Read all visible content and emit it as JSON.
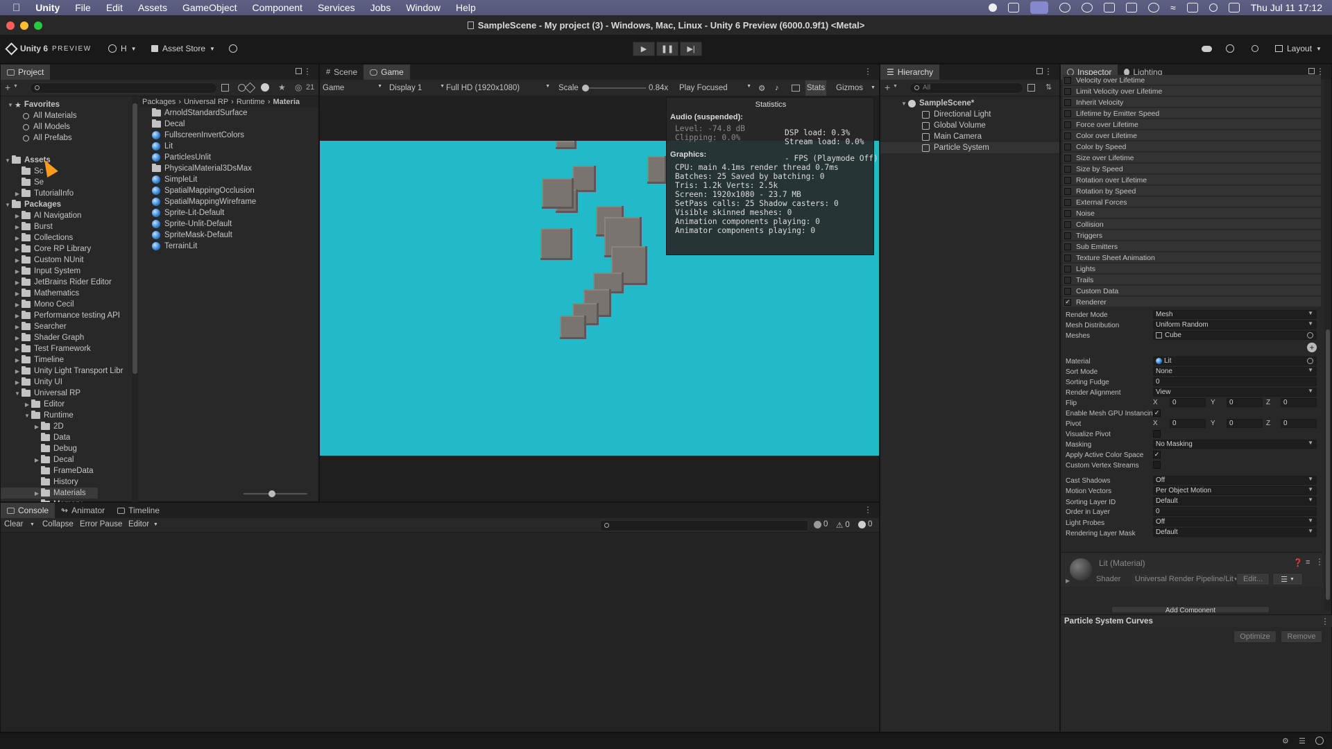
{
  "macbar": {
    "app": "Unity",
    "menus": [
      "File",
      "Edit",
      "Assets",
      "GameObject",
      "Component",
      "Services",
      "Jobs",
      "Window",
      "Help"
    ],
    "clock": "Thu Jul 11  17:12"
  },
  "window": {
    "title": "SampleScene - My project (3) - Windows, Mac, Linux - Unity 6 Preview (6000.0.9f1) <Metal>"
  },
  "toolbar": {
    "brand": "Unity 6",
    "brand_suffix": "PREVIEW",
    "account_label": "H",
    "asset_store": "Asset Store",
    "layout": "Layout"
  },
  "project": {
    "tab": "Project",
    "hidden_count": "21",
    "favorites_label": "Favorites",
    "favorites": [
      "All Materials",
      "All Models",
      "All Prefabs"
    ],
    "assets_label": "Assets",
    "assets_children": [
      "Sc",
      "Se",
      "TutorialInfo"
    ],
    "packages_label": "Packages",
    "packages": [
      "AI Navigation",
      "Burst",
      "Collections",
      "Core RP Library",
      "Custom NUnit",
      "Input System",
      "JetBrains Rider Editor",
      "Mathematics",
      "Mono Cecil",
      "Performance testing API",
      "Searcher",
      "Shader Graph",
      "Test Framework",
      "Timeline",
      "Unity Light Transport Libr",
      "Unity UI"
    ],
    "urp_label": "Universal RP",
    "urp_children": [
      "Editor",
      "Runtime"
    ],
    "runtime_children": [
      "2D",
      "Data",
      "Debug",
      "Decal",
      "FrameData",
      "History",
      "Materials",
      "Memory"
    ],
    "breadcrumb": [
      "Packages",
      "Universal RP",
      "Runtime",
      "Materia"
    ],
    "files": [
      {
        "name": "ArnoldStandardSurface",
        "kind": "folder"
      },
      {
        "name": "Decal",
        "kind": "folder"
      },
      {
        "name": "FullscreenInvertColors",
        "kind": "mat"
      },
      {
        "name": "Lit",
        "kind": "mat"
      },
      {
        "name": "ParticlesUnlit",
        "kind": "mat"
      },
      {
        "name": "PhysicalMaterial3DsMax",
        "kind": "folder"
      },
      {
        "name": "SimpleLit",
        "kind": "mat"
      },
      {
        "name": "SpatialMappingOcclusion",
        "kind": "mat"
      },
      {
        "name": "SpatialMappingWireframe",
        "kind": "mat"
      },
      {
        "name": "Sprite-Lit-Default",
        "kind": "mat"
      },
      {
        "name": "Sprite-Unlit-Default",
        "kind": "mat"
      },
      {
        "name": "SpriteMask-Default",
        "kind": "mat"
      },
      {
        "name": "TerrainLit",
        "kind": "mat"
      }
    ]
  },
  "game": {
    "tabs": [
      "Scene",
      "Game"
    ],
    "mode": "Game",
    "display": "Display 1",
    "resolution": "Full HD (1920x1080)",
    "scale_label": "Scale",
    "scale_value": "0.84x",
    "play_mode": "Play Focused",
    "stats_btn": "Stats",
    "gizmos_btn": "Gizmos",
    "scale_fraction": 0.05,
    "background_color": "#22b9c8"
  },
  "stats": {
    "title": "Statistics",
    "audio_head": "Audio (suspended):",
    "level": "Level: -74.8 dB",
    "clipping": "Clipping: 0.0%",
    "dsp": "DSP load: 0.3%",
    "stream": "Stream load: 0.0%",
    "graphics_head": "Graphics:",
    "fps": "- FPS (Playmode Off)",
    "lines": [
      "CPU: main 4.1ms  render thread 0.7ms",
      "Batches: 25     Saved by batching: 0",
      "Tris: 1.2k   Verts: 2.5k",
      "Screen: 1920x1080 - 23.7 MB",
      "SetPass calls: 25  Shadow casters: 0",
      "Visible skinned meshes: 0",
      "Animation components playing: 0",
      "Animator components playing: 0"
    ]
  },
  "hierarchy": {
    "tab": "Hierarchy",
    "search_placeholder": "All",
    "scene": "SampleScene*",
    "items": [
      "Directional Light",
      "Global Volume",
      "Main Camera",
      "Particle System"
    ]
  },
  "inspector": {
    "tabs": [
      "Inspector",
      "Lighting"
    ],
    "modules": [
      {
        "name": "Velocity over Lifetime",
        "checked": false
      },
      {
        "name": "Limit Velocity over Lifetime",
        "checked": false
      },
      {
        "name": "Inherit Velocity",
        "checked": false
      },
      {
        "name": "Lifetime by Emitter Speed",
        "checked": false
      },
      {
        "name": "Force over Lifetime",
        "checked": false
      },
      {
        "name": "Color over Lifetime",
        "checked": false
      },
      {
        "name": "Color by Speed",
        "checked": false
      },
      {
        "name": "Size over Lifetime",
        "checked": false
      },
      {
        "name": "Size by Speed",
        "checked": false
      },
      {
        "name": "Rotation over Lifetime",
        "checked": false
      },
      {
        "name": "Rotation by Speed",
        "checked": false
      },
      {
        "name": "External Forces",
        "checked": false
      },
      {
        "name": "Noise",
        "checked": false
      },
      {
        "name": "Collision",
        "checked": false
      },
      {
        "name": "Triggers",
        "checked": false
      },
      {
        "name": "Sub Emitters",
        "checked": false
      },
      {
        "name": "Texture Sheet Animation",
        "checked": false
      },
      {
        "name": "Lights",
        "checked": false
      },
      {
        "name": "Trails",
        "checked": false
      },
      {
        "name": "Custom Data",
        "checked": false
      },
      {
        "name": "Renderer",
        "checked": true
      }
    ],
    "check_glyph": "✓",
    "renderer": {
      "render_mode": {
        "label": "Render Mode",
        "value": "Mesh"
      },
      "mesh_distribution": {
        "label": "Mesh Distribution",
        "value": "Uniform Random"
      },
      "meshes": {
        "label": "Meshes",
        "value": "Cube"
      },
      "material": {
        "label": "Material",
        "value": "Lit"
      },
      "sort_mode": {
        "label": "Sort Mode",
        "value": "None"
      },
      "sorting_fudge": {
        "label": "Sorting Fudge",
        "value": "0"
      },
      "render_alignment": {
        "label": "Render Alignment",
        "value": "View"
      },
      "flip": {
        "label": "Flip",
        "x": "0",
        "y": "0",
        "z": "0"
      },
      "gpu_instancing": {
        "label": "Enable Mesh GPU Instancing",
        "checked": true
      },
      "pivot": {
        "label": "Pivot",
        "x": "0",
        "y": "0",
        "z": "0"
      },
      "visualize_pivot": {
        "label": "Visualize Pivot",
        "checked": false
      },
      "masking": {
        "label": "Masking",
        "value": "No Masking"
      },
      "active_color_space": {
        "label": "Apply Active Color Space",
        "checked": true
      },
      "custom_vertex_streams": {
        "label": "Custom Vertex Streams",
        "checked": false
      },
      "cast_shadows": {
        "label": "Cast Shadows",
        "value": "Off"
      },
      "motion_vectors": {
        "label": "Motion Vectors",
        "value": "Per Object Motion"
      },
      "sorting_layer": {
        "label": "Sorting Layer ID",
        "value": "Default"
      },
      "order_in_layer": {
        "label": "Order in Layer",
        "value": "0"
      },
      "light_probes": {
        "label": "Light Probes",
        "value": "Off"
      },
      "rendering_layer_mask": {
        "label": "Rendering Layer Mask",
        "value": "Default"
      }
    },
    "axis_labels": [
      "X",
      "Y",
      "Z"
    ],
    "material_header": "Lit (Material)",
    "shader_label": "Shader",
    "shader_value": "Universal Render Pipeline/Lit",
    "edit_btn": "Edit...",
    "add_component": "Add Component",
    "curves_title": "Particle System Curves",
    "optimize_btn": "Optimize",
    "remove_btn": "Remove"
  },
  "console": {
    "tabs": [
      "Console",
      "Animator",
      "Timeline"
    ],
    "clear": "Clear",
    "collapse": "Collapse",
    "error_pause": "Error Pause",
    "editor": "Editor",
    "count_log": "0",
    "count_warn": "0",
    "count_err": "0"
  }
}
